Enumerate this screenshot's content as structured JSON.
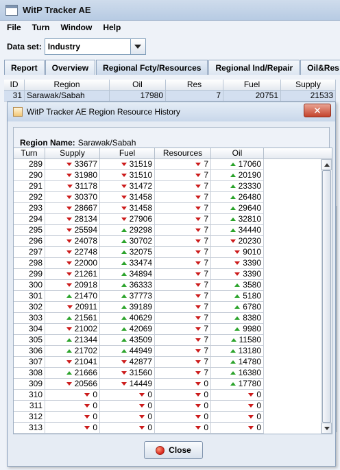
{
  "main_window": {
    "title": "WitP Tracker AE",
    "menu": [
      "File",
      "Turn",
      "Window",
      "Help"
    ],
    "dataset_label": "Data set:",
    "dataset_value": "Industry",
    "tabs": [
      "Report",
      "Overview",
      "Regional Fcty/Resources",
      "Regional Ind/Repair",
      "Oil&Res"
    ],
    "active_tab": "Regional Fcty/Resources",
    "table": {
      "headers": [
        "ID",
        "Region",
        "Oil",
        "Res",
        "Fuel",
        "Supply"
      ],
      "row": [
        "31",
        "Sarawak/Sabah",
        "17980",
        "7",
        "20751",
        "21533"
      ]
    }
  },
  "dialog": {
    "title": "WitP Tracker AE Region Resource History",
    "region_label": "Region Name:",
    "region_value": "Sarawak/Sabah",
    "columns": [
      "Turn",
      "Supply",
      "Fuel",
      "Resources",
      "Oil"
    ],
    "rows": [
      {
        "turn": "289",
        "supply": "33677",
        "supply_dir": "down",
        "fuel": "31519",
        "fuel_dir": "down",
        "res": "7",
        "res_dir": "down",
        "oil": "17060",
        "oil_dir": "up"
      },
      {
        "turn": "290",
        "supply": "31980",
        "supply_dir": "down",
        "fuel": "31510",
        "fuel_dir": "down",
        "res": "7",
        "res_dir": "down",
        "oil": "20190",
        "oil_dir": "up"
      },
      {
        "turn": "291",
        "supply": "31178",
        "supply_dir": "down",
        "fuel": "31472",
        "fuel_dir": "down",
        "res": "7",
        "res_dir": "down",
        "oil": "23330",
        "oil_dir": "up"
      },
      {
        "turn": "292",
        "supply": "30370",
        "supply_dir": "down",
        "fuel": "31458",
        "fuel_dir": "down",
        "res": "7",
        "res_dir": "down",
        "oil": "26480",
        "oil_dir": "up"
      },
      {
        "turn": "293",
        "supply": "28667",
        "supply_dir": "down",
        "fuel": "31458",
        "fuel_dir": "down",
        "res": "7",
        "res_dir": "down",
        "oil": "29640",
        "oil_dir": "up"
      },
      {
        "turn": "294",
        "supply": "28134",
        "supply_dir": "down",
        "fuel": "27906",
        "fuel_dir": "down",
        "res": "7",
        "res_dir": "down",
        "oil": "32810",
        "oil_dir": "up"
      },
      {
        "turn": "295",
        "supply": "25594",
        "supply_dir": "down",
        "fuel": "29298",
        "fuel_dir": "up",
        "res": "7",
        "res_dir": "down",
        "oil": "34440",
        "oil_dir": "up"
      },
      {
        "turn": "296",
        "supply": "24078",
        "supply_dir": "down",
        "fuel": "30702",
        "fuel_dir": "up",
        "res": "7",
        "res_dir": "down",
        "oil": "20230",
        "oil_dir": "down"
      },
      {
        "turn": "297",
        "supply": "22748",
        "supply_dir": "down",
        "fuel": "32075",
        "fuel_dir": "up",
        "res": "7",
        "res_dir": "down",
        "oil": "9010",
        "oil_dir": "down"
      },
      {
        "turn": "298",
        "supply": "22000",
        "supply_dir": "down",
        "fuel": "33474",
        "fuel_dir": "up",
        "res": "7",
        "res_dir": "down",
        "oil": "3390",
        "oil_dir": "down"
      },
      {
        "turn": "299",
        "supply": "21261",
        "supply_dir": "down",
        "fuel": "34894",
        "fuel_dir": "up",
        "res": "7",
        "res_dir": "down",
        "oil": "3390",
        "oil_dir": "down"
      },
      {
        "turn": "300",
        "supply": "20918",
        "supply_dir": "down",
        "fuel": "36333",
        "fuel_dir": "up",
        "res": "7",
        "res_dir": "down",
        "oil": "3580",
        "oil_dir": "up"
      },
      {
        "turn": "301",
        "supply": "21470",
        "supply_dir": "up",
        "fuel": "37773",
        "fuel_dir": "up",
        "res": "7",
        "res_dir": "down",
        "oil": "5180",
        "oil_dir": "up"
      },
      {
        "turn": "302",
        "supply": "20911",
        "supply_dir": "down",
        "fuel": "39189",
        "fuel_dir": "up",
        "res": "7",
        "res_dir": "down",
        "oil": "6780",
        "oil_dir": "up"
      },
      {
        "turn": "303",
        "supply": "21561",
        "supply_dir": "up",
        "fuel": "40629",
        "fuel_dir": "up",
        "res": "7",
        "res_dir": "down",
        "oil": "8380",
        "oil_dir": "up"
      },
      {
        "turn": "304",
        "supply": "21002",
        "supply_dir": "down",
        "fuel": "42069",
        "fuel_dir": "up",
        "res": "7",
        "res_dir": "down",
        "oil": "9980",
        "oil_dir": "up"
      },
      {
        "turn": "305",
        "supply": "21344",
        "supply_dir": "up",
        "fuel": "43509",
        "fuel_dir": "up",
        "res": "7",
        "res_dir": "down",
        "oil": "11580",
        "oil_dir": "up"
      },
      {
        "turn": "306",
        "supply": "21702",
        "supply_dir": "up",
        "fuel": "44949",
        "fuel_dir": "up",
        "res": "7",
        "res_dir": "down",
        "oil": "13180",
        "oil_dir": "up"
      },
      {
        "turn": "307",
        "supply": "21041",
        "supply_dir": "down",
        "fuel": "42877",
        "fuel_dir": "down",
        "res": "7",
        "res_dir": "down",
        "oil": "14780",
        "oil_dir": "up"
      },
      {
        "turn": "308",
        "supply": "21666",
        "supply_dir": "up",
        "fuel": "31560",
        "fuel_dir": "down",
        "res": "7",
        "res_dir": "down",
        "oil": "16380",
        "oil_dir": "up"
      },
      {
        "turn": "309",
        "supply": "20566",
        "supply_dir": "down",
        "fuel": "14449",
        "fuel_dir": "down",
        "res": "0",
        "res_dir": "down",
        "oil": "17780",
        "oil_dir": "up"
      },
      {
        "turn": "310",
        "supply": "0",
        "supply_dir": "down",
        "fuel": "0",
        "fuel_dir": "down",
        "res": "0",
        "res_dir": "down",
        "oil": "0",
        "oil_dir": "down"
      },
      {
        "turn": "311",
        "supply": "0",
        "supply_dir": "down",
        "fuel": "0",
        "fuel_dir": "down",
        "res": "0",
        "res_dir": "down",
        "oil": "0",
        "oil_dir": "down"
      },
      {
        "turn": "312",
        "supply": "0",
        "supply_dir": "down",
        "fuel": "0",
        "fuel_dir": "down",
        "res": "0",
        "res_dir": "down",
        "oil": "0",
        "oil_dir": "down"
      },
      {
        "turn": "313",
        "supply": "0",
        "supply_dir": "down",
        "fuel": "0",
        "fuel_dir": "down",
        "res": "0",
        "res_dir": "down",
        "oil": "0",
        "oil_dir": "down"
      }
    ],
    "close_label": "Close",
    "colors": {
      "up": "#2aa32a",
      "down": "#cc1a1a"
    },
    "icons": {
      "trend_up": "green-up-arrow-icon",
      "trend_down": "red-down-arrow-icon"
    }
  }
}
